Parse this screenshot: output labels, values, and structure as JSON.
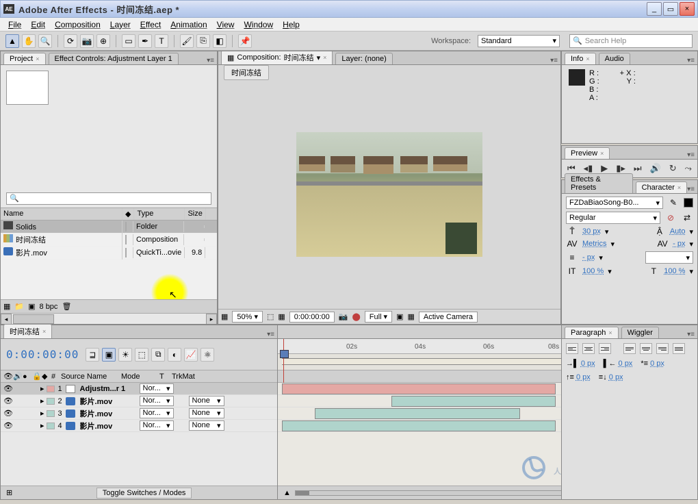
{
  "window": {
    "app_badge": "AE",
    "title": "Adobe After Effects - 时间冻结.aep *",
    "min": "_",
    "max": "▭",
    "close": "×"
  },
  "menu": [
    "File",
    "Edit",
    "Composition",
    "Layer",
    "Effect",
    "Animation",
    "View",
    "Window",
    "Help"
  ],
  "workspace": {
    "label": "Workspace:",
    "value": "Standard",
    "caret": "▾"
  },
  "search": {
    "placeholder": "Search Help",
    "icon": "🔍"
  },
  "project": {
    "tab": "Project",
    "effect_tab": "Effect Controls: Adjustment Layer 1",
    "search_icon": "🔍",
    "cols": {
      "name": "Name",
      "tag": "◆",
      "type": "Type",
      "size": "Size"
    },
    "rows": [
      {
        "name": "Solids",
        "type": "Folder",
        "size": "",
        "icon": "folder",
        "selected": true
      },
      {
        "name": "时间冻结",
        "type": "Composition",
        "size": "",
        "icon": "comp"
      },
      {
        "name": "影片.mov",
        "type": "QuickTi...ovie",
        "size": "9.8",
        "icon": "mov"
      }
    ],
    "bpc": "8 bpc"
  },
  "composition": {
    "tab_prefix": "Composition:",
    "tab_name": "时间冻结",
    "layer_tab": "Layer: (none)",
    "chip": "时间冻结",
    "footer": {
      "zoom": "50%",
      "time": "0:00:00:00",
      "res": "Full",
      "camera": "Active Camera"
    }
  },
  "info": {
    "tab": "Info",
    "audio_tab": "Audio",
    "R": "R :",
    "G": "G :",
    "B": "B :",
    "A": "A :",
    "X": "X :",
    "Y": "Y :",
    "plus": "+"
  },
  "preview": {
    "tab": "Preview"
  },
  "effects_presets": {
    "tab": "Effects & Presets"
  },
  "character": {
    "tab": "Character",
    "font": "FZDaBiaoSong-B0...",
    "style": "Regular",
    "size": "30 px",
    "leading": "Auto",
    "metrics": "Metrics",
    "tracking": "- px",
    "scale_v": "100 %",
    "scale_h": "100 %",
    "baseline": "- px"
  },
  "timeline": {
    "tab": "时间冻结",
    "timecode": "0:00:00:00",
    "ruler": [
      "02s",
      "04s",
      "06s",
      "08s"
    ],
    "cols": {
      "source": "Source Name",
      "mode": "Mode",
      "t": "T",
      "trkmat": "TrkMat"
    },
    "layers": [
      {
        "idx": "1",
        "name": "Adjustm...r 1",
        "mode": "Nor...",
        "trkmat": "",
        "icon": "adj",
        "bar": "adj",
        "start": 0,
        "end": 100
      },
      {
        "idx": "2",
        "name": "影片.mov",
        "mode": "Nor...",
        "trkmat": "None",
        "icon": "mov",
        "bar": "vid",
        "start": 40,
        "end": 100
      },
      {
        "idx": "3",
        "name": "影片.mov",
        "mode": "Nor...",
        "trkmat": "None",
        "icon": "mov",
        "bar": "vid",
        "start": 12,
        "end": 87
      },
      {
        "idx": "4",
        "name": "影片.mov",
        "mode": "Nor...",
        "trkmat": "None",
        "icon": "mov",
        "bar": "vid",
        "start": 0,
        "end": 100
      }
    ],
    "toggle": "Toggle Switches / Modes"
  },
  "paragraph": {
    "tab": "Paragraph",
    "wiggler_tab": "Wiggler",
    "indents": [
      "0 px",
      "0 px",
      "0 px",
      "0 px",
      "0 px"
    ]
  },
  "watermark": "人人素材"
}
